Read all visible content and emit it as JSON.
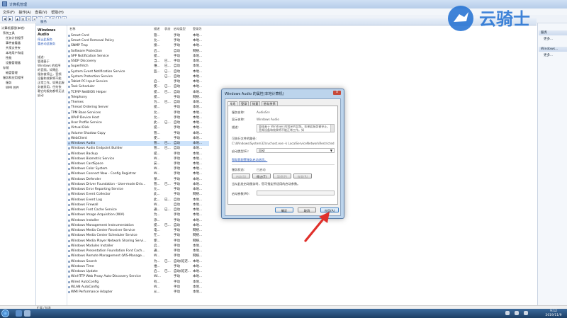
{
  "window": {
    "title": "计算机管理"
  },
  "menu": [
    "文件(F)",
    "操作(A)",
    "查看(V)",
    "帮助(H)"
  ],
  "tree": [
    "计算机管理(本地)",
    "系统工具",
    "任务计划程序",
    "事件查看器",
    "共享文件夹",
    "本地用户和组",
    "性能",
    "设备管理器",
    "存储",
    "磁盘管理",
    "服务和应用程序",
    "服务",
    "WMI 控件"
  ],
  "services_header": "服务",
  "desc_pane": {
    "heading": "Windows Audio",
    "links": [
      "停止此服务",
      "重启动此服务"
    ],
    "desc_label": "描述:",
    "desc_lines": [
      "管理基于",
      "Windows 的程序",
      "的音频。如果此",
      "服务被停止，音频",
      "设备和效果将不能",
      "正常工作。如果此服",
      "务被禁用，任何依",
      "赖它的服务都将无法",
      "启动"
    ]
  },
  "columns": {
    "name": "名称",
    "desc": "描述",
    "status": "状态",
    "startup": "启动类型",
    "logon": "登录为"
  },
  "services": [
    {
      "name": "Smart Card",
      "desc": "管...",
      "status": "",
      "startup": "手动",
      "logon": "本地..."
    },
    {
      "name": "Smart Card Removal Policy",
      "desc": "允...",
      "status": "",
      "startup": "手动",
      "logon": "本地..."
    },
    {
      "name": "SNMP Trap",
      "desc": "接...",
      "status": "",
      "startup": "手动",
      "logon": "本地..."
    },
    {
      "name": "Software Protection",
      "desc": "启...",
      "status": "",
      "startup": "自动",
      "logon": "网络..."
    },
    {
      "name": "SPP Notification Service",
      "desc": "提...",
      "status": "",
      "startup": "手动",
      "logon": "本地..."
    },
    {
      "name": "SSDP Discovery",
      "desc": "当...",
      "status": "已...",
      "startup": "手动",
      "logon": "本地..."
    },
    {
      "name": "Superfetch",
      "desc": "维...",
      "status": "已...",
      "startup": "自动",
      "logon": "本地..."
    },
    {
      "name": "System Event Notification Service",
      "desc": "监...",
      "status": "已...",
      "startup": "自动",
      "logon": "本地..."
    },
    {
      "name": "System Protection Service",
      "desc": "",
      "status": "已...",
      "startup": "自动",
      "logon": "本地..."
    },
    {
      "name": "Tablet PC Input Service",
      "desc": "启...",
      "status": "",
      "startup": "手动",
      "logon": "本地..."
    },
    {
      "name": "Task Scheduler",
      "desc": "使...",
      "status": "已...",
      "startup": "自动",
      "logon": "本地..."
    },
    {
      "name": "TCP/IP NetBIOS Helper",
      "desc": "提...",
      "status": "已...",
      "startup": "自动",
      "logon": "本地..."
    },
    {
      "name": "Telephony",
      "desc": "提...",
      "status": "",
      "startup": "手动",
      "logon": "网络..."
    },
    {
      "name": "Themes",
      "desc": "为...",
      "status": "已...",
      "startup": "自动",
      "logon": "本地..."
    },
    {
      "name": "Thread Ordering Server",
      "desc": "提...",
      "status": "",
      "startup": "手动",
      "logon": "本地..."
    },
    {
      "name": "TPM Base Services",
      "desc": "允...",
      "status": "",
      "startup": "手动",
      "logon": "本地..."
    },
    {
      "name": "UPnP Device Host",
      "desc": "允...",
      "status": "",
      "startup": "手动",
      "logon": "本地..."
    },
    {
      "name": "User Profile Service",
      "desc": "此...",
      "status": "已...",
      "startup": "自动",
      "logon": "本地..."
    },
    {
      "name": "Virtual Disk",
      "desc": "提...",
      "status": "",
      "startup": "手动",
      "logon": "本地..."
    },
    {
      "name": "Volume Shadow Copy",
      "desc": "管...",
      "status": "",
      "startup": "手动",
      "logon": "本地..."
    },
    {
      "name": "WebClient",
      "desc": "使...",
      "status": "",
      "startup": "手动",
      "logon": "本地..."
    },
    {
      "name": "Windows Audio",
      "desc": "管...",
      "status": "已...",
      "startup": "自动",
      "logon": "本地..."
    },
    {
      "name": "Windows Audio Endpoint Builder",
      "desc": "管...",
      "status": "已...",
      "startup": "自动",
      "logon": "本地..."
    },
    {
      "name": "Windows Backup",
      "desc": "提...",
      "status": "",
      "startup": "手动",
      "logon": "本地..."
    },
    {
      "name": "Windows Biometric Service",
      "desc": "W...",
      "status": "",
      "startup": "手动",
      "logon": "本地..."
    },
    {
      "name": "Windows CardSpace",
      "desc": "安...",
      "status": "",
      "startup": "手动",
      "logon": "本地..."
    },
    {
      "name": "Windows Color System",
      "desc": "W...",
      "status": "",
      "startup": "手动",
      "logon": "本地..."
    },
    {
      "name": "Windows Connect Now - Config Registrar",
      "desc": "W...",
      "status": "",
      "startup": "手动",
      "logon": "本地..."
    },
    {
      "name": "Windows Defender",
      "desc": "保...",
      "status": "",
      "startup": "手动",
      "logon": "本地..."
    },
    {
      "name": "Windows Driver Foundation - User-mode Driv...",
      "desc": "管...",
      "status": "已...",
      "startup": "手动",
      "logon": "本地..."
    },
    {
      "name": "Windows Error Reporting Service",
      "desc": "允...",
      "status": "",
      "startup": "手动",
      "logon": "本地..."
    },
    {
      "name": "Windows Event Collector",
      "desc": "此...",
      "status": "",
      "startup": "手动",
      "logon": "网络..."
    },
    {
      "name": "Windows Event Log",
      "desc": "此...",
      "status": "已...",
      "startup": "自动",
      "logon": "本地..."
    },
    {
      "name": "Windows Firewall",
      "desc": "W...",
      "status": "",
      "startup": "自动",
      "logon": "本地..."
    },
    {
      "name": "Windows Font Cache Service",
      "desc": "通...",
      "status": "已...",
      "startup": "自动",
      "logon": "本地..."
    },
    {
      "name": "Windows Image Acquisition (WIA)",
      "desc": "为...",
      "status": "",
      "startup": "手动",
      "logon": "本地..."
    },
    {
      "name": "Windows Installer",
      "desc": "添...",
      "status": "",
      "startup": "手动",
      "logon": "本地..."
    },
    {
      "name": "Windows Management Instrumentation",
      "desc": "提...",
      "status": "已...",
      "startup": "自动",
      "logon": "本地..."
    },
    {
      "name": "Windows Media Center Receiver Service",
      "desc": "电...",
      "status": "",
      "startup": "手动",
      "logon": "网络..."
    },
    {
      "name": "Windows Media Center Scheduler Service",
      "desc": "在...",
      "status": "",
      "startup": "手动",
      "logon": "网络..."
    },
    {
      "name": "Windows Media Player Network Sharing Servi...",
      "desc": "使...",
      "status": "",
      "startup": "手动",
      "logon": "网络..."
    },
    {
      "name": "Windows Modules Installer",
      "desc": "启...",
      "status": "",
      "startup": "手动",
      "logon": "本地..."
    },
    {
      "name": "Windows Presentation Foundation Font Cach...",
      "desc": "通...",
      "status": "",
      "startup": "手动",
      "logon": "本地..."
    },
    {
      "name": "Windows Remote Management (WS-Manage...",
      "desc": "W...",
      "status": "",
      "startup": "手动",
      "logon": "网络..."
    },
    {
      "name": "Windows Search",
      "desc": "为...",
      "status": "已...",
      "startup": "自动(延迟...",
      "logon": "本地..."
    },
    {
      "name": "Windows Time",
      "desc": "维...",
      "status": "",
      "startup": "手动",
      "logon": "本地..."
    },
    {
      "name": "Windows Update",
      "desc": "启...",
      "status": "已...",
      "startup": "自动(延迟...",
      "logon": "本地..."
    },
    {
      "name": "WinHTTP Web Proxy Auto-Discovery Service",
      "desc": "Wi...",
      "status": "",
      "startup": "手动",
      "logon": "本地..."
    },
    {
      "name": "Wired AutoConfig",
      "desc": "有...",
      "status": "",
      "startup": "手动",
      "logon": "本地..."
    },
    {
      "name": "WLAN AutoConfig",
      "desc": "W...",
      "status": "",
      "startup": "手动",
      "logon": "本地..."
    },
    {
      "name": "WMI Performance Adapter",
      "desc": "从...",
      "status": "",
      "startup": "手动",
      "logon": "本地..."
    }
  ],
  "selected_index": 21,
  "actions": {
    "head1": "服务",
    "item1": "更多...",
    "head2": "Windows...",
    "item2": "更多..."
  },
  "status_bar": {
    "tabs": "扩展 / 标准"
  },
  "dialog": {
    "title": "Windows Audio 的属性(本地计算机)",
    "close": "X",
    "tabs": [
      "常规",
      "登录",
      "恢复",
      "依存关系"
    ],
    "service_name_label": "服务名称:",
    "service_name": "AudioSrv",
    "display_name_label": "显示名称:",
    "display_name": "Windows Audio",
    "desc_label": "描述:",
    "desc_text": "管理基于 Windows 的程序的音频。如果此服务被停止，音频设备和效果将不能正常工作。如",
    "path_label": "可执行文件的路径:",
    "path_value": "C:\\Windows\\System32\\svchost.exe -k LocalServiceNetworkRestricted",
    "startup_label": "启动类型(E):",
    "startup_value": "自动",
    "help_link": "帮助我配置服务启动选项。",
    "status_label": "服务状态:",
    "status_value": "已启动",
    "btn_start": "启动(S)",
    "btn_stop": "停止(T)",
    "btn_pause": "暂停(P)",
    "btn_resume": "恢复(R)",
    "hint": "当从此处启动服务时，您可指定所适用的启动参数。",
    "params_label": "启动参数(M):",
    "ok": "确定",
    "cancel": "取消",
    "apply": "应用(A)"
  },
  "taskbar": {
    "time": "9:12",
    "date": "2019/11/9"
  },
  "watermark": {
    "text": "云骑士"
  },
  "colors": {
    "accent": "#1f6fd1",
    "arrow": "#e0302b",
    "selected_row": "#cde3fb"
  }
}
